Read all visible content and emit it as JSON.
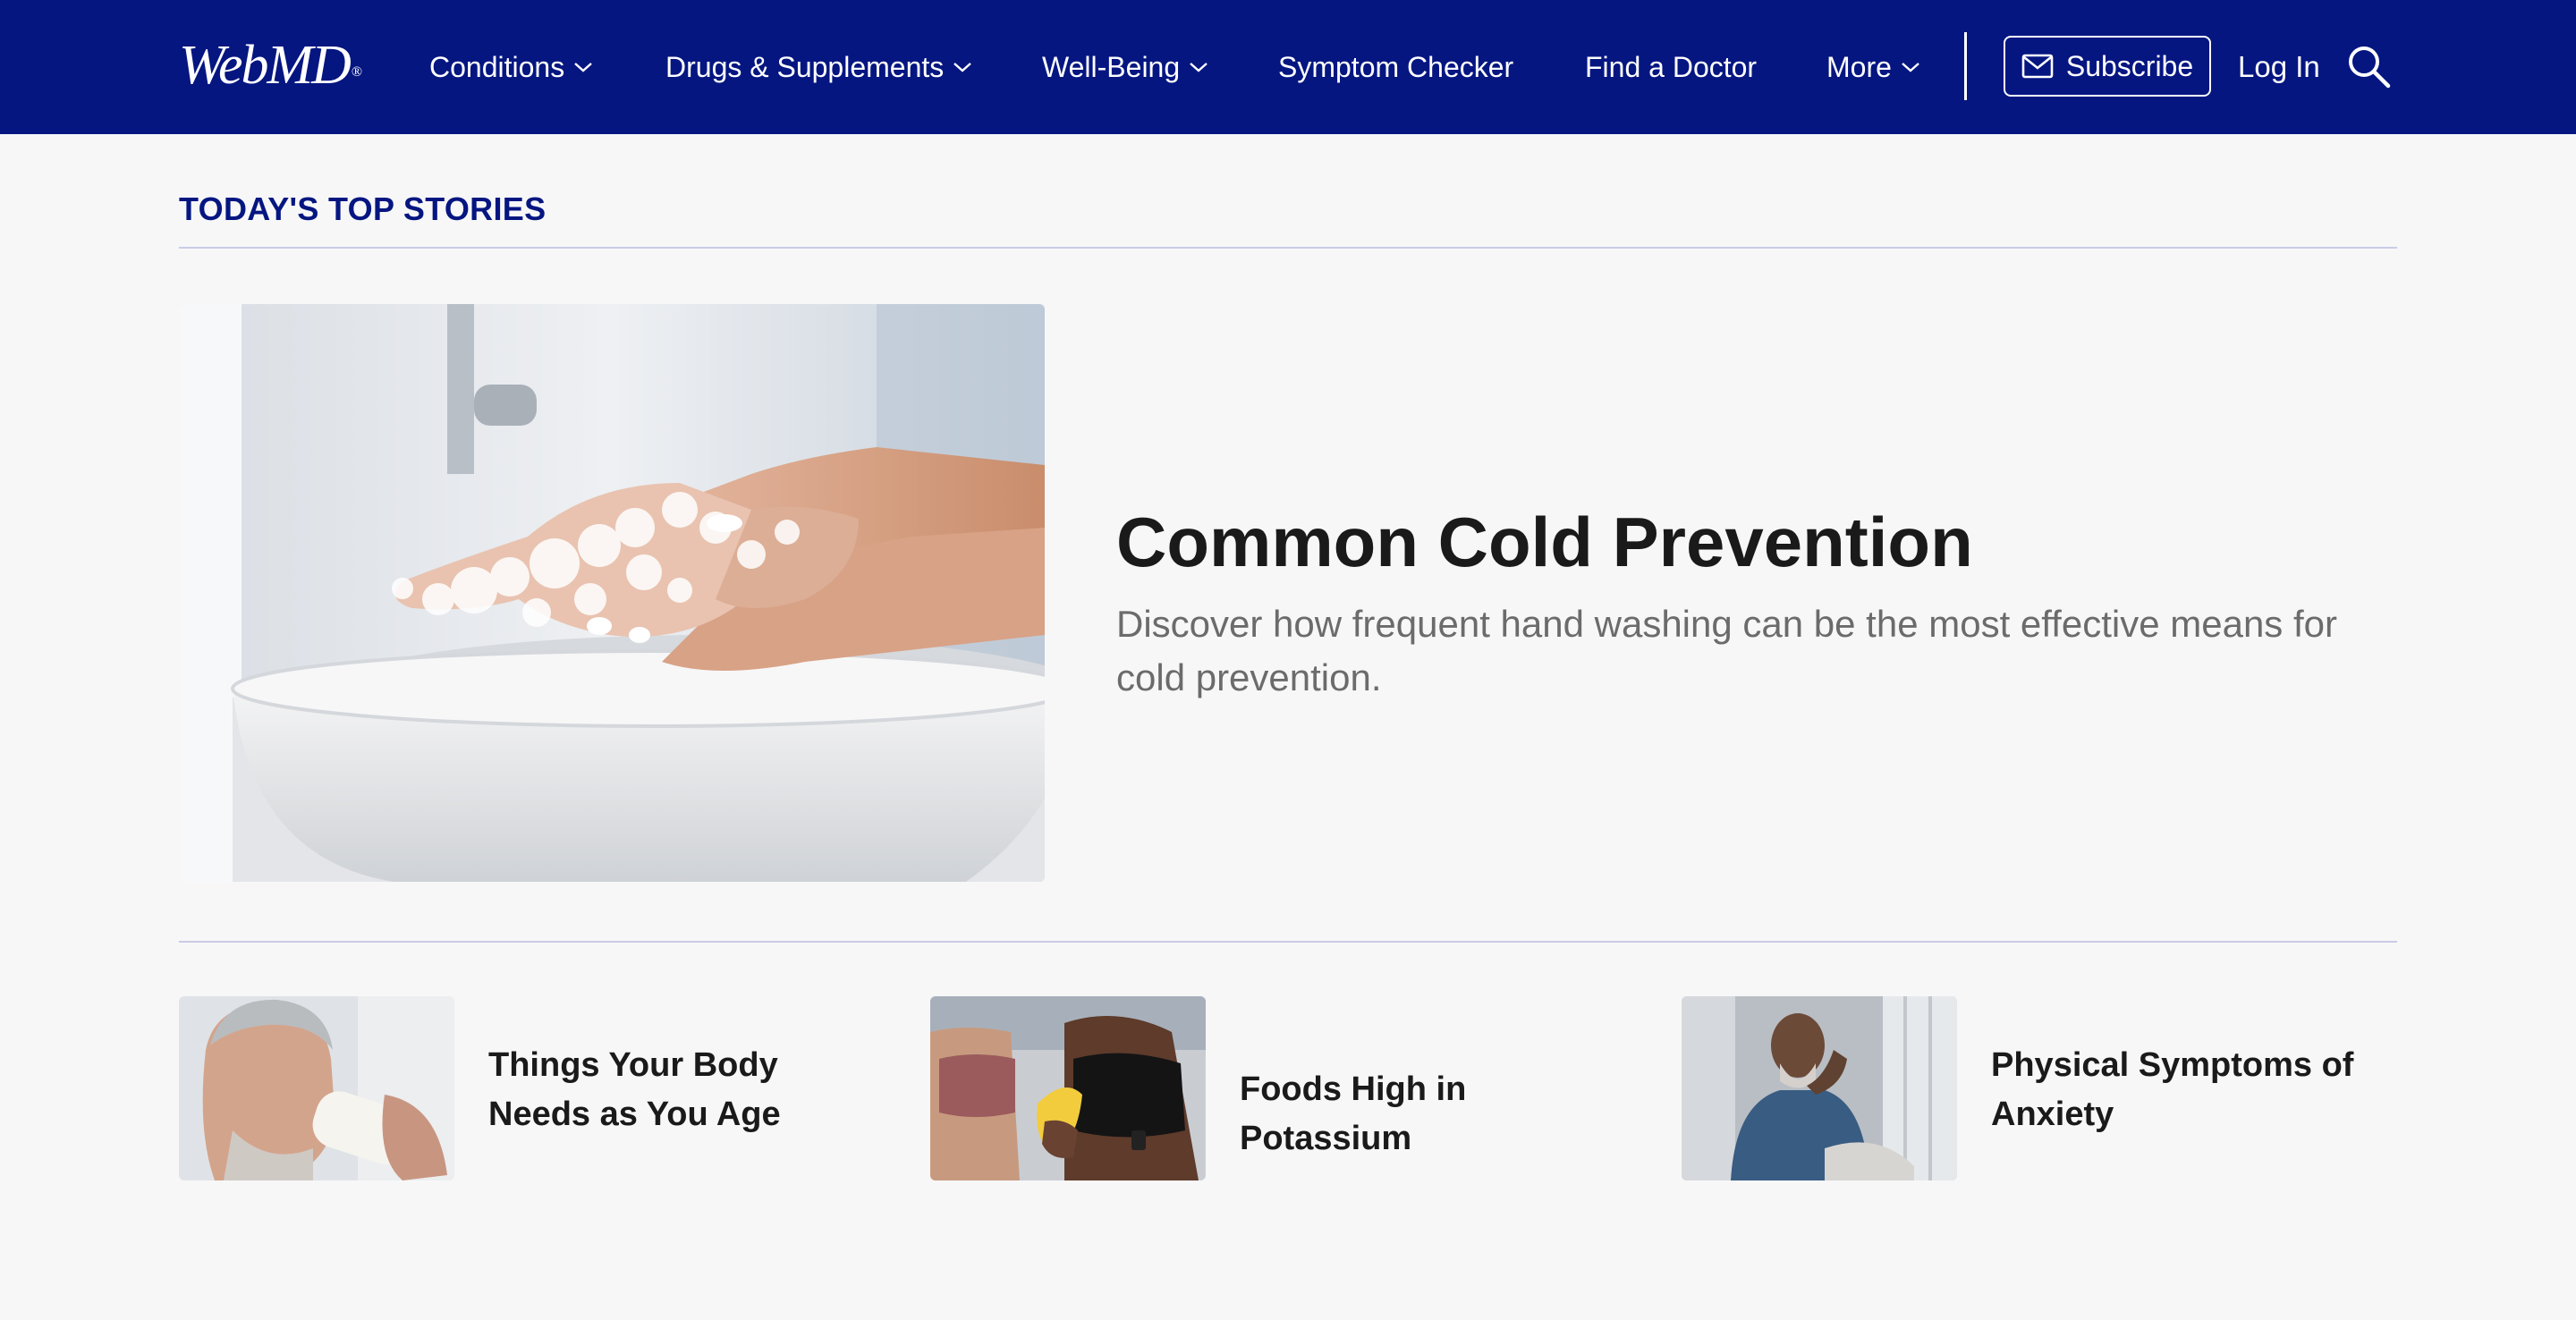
{
  "brand": {
    "logo_text": "WebMD",
    "registered": "®"
  },
  "nav": {
    "items": [
      {
        "label": "Conditions",
        "has_dropdown": true
      },
      {
        "label": "Drugs & Supplements",
        "has_dropdown": true
      },
      {
        "label": "Well-Being",
        "has_dropdown": true
      },
      {
        "label": "Symptom Checker",
        "has_dropdown": false
      },
      {
        "label": "Find a Doctor",
        "has_dropdown": false
      },
      {
        "label": "More",
        "has_dropdown": true
      }
    ],
    "subscribe_label": "Subscribe",
    "login_label": "Log In",
    "icons": {
      "dropdown": "chevron-down-icon",
      "subscribe": "mail-icon",
      "search": "search-icon"
    }
  },
  "top_stories": {
    "heading": "TODAY'S TOP STORIES",
    "featured": {
      "title": "Common Cold Prevention",
      "description": "Discover how frequent hand washing can be the most effective means for cold prevention.",
      "image": "hand-washing-photo"
    },
    "stories": [
      {
        "title": "Things Your Body Needs as You Age",
        "image": "man-drinking-milk-photo"
      },
      {
        "title": "Foods High in Potassium",
        "image": "women-holding-banana-photo"
      },
      {
        "title": "Physical Symptoms of Anxiety",
        "image": "man-by-window-photo"
      }
    ]
  },
  "colors": {
    "nav_background": "#051681",
    "heading_accent": "#051681",
    "page_background": "#f7f7f8",
    "divider": "#c9cce6",
    "body_text": "#1a1a1a",
    "muted_text": "#6b6b6b"
  }
}
